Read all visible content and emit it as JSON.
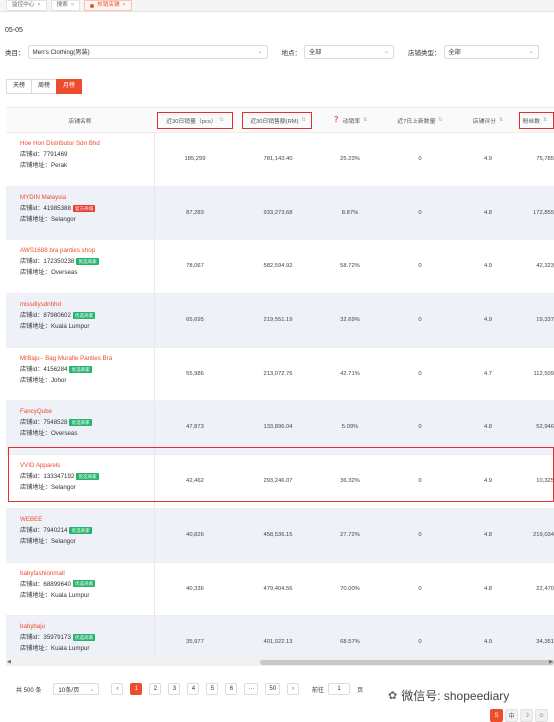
{
  "tabs": [
    {
      "label": "监控中心"
    },
    {
      "label": "搜索"
    },
    {
      "label": "热销店铺"
    }
  ],
  "date": "05-05",
  "filters": {
    "category_label": "类目：",
    "category_value": "Men's Clothing(男装)",
    "location_label": "地点：",
    "location_value": "全部",
    "shop_type_label": "店铺类型：",
    "shop_type_value": "全部"
  },
  "period": {
    "day": "天榜",
    "week": "周榜",
    "month": "月榜"
  },
  "columns": {
    "shop": "店铺名称",
    "sales30": "近30日销量（pcs）",
    "revenue30": "近30日销售额(RM)",
    "conversion": "动销率",
    "new7": "近7日上新数量",
    "rating": "店铺评分",
    "followers": "粉丝数"
  },
  "labels": {
    "shop_id": "店铺id：",
    "shop_addr": "店铺地址："
  },
  "rows": [
    {
      "name": "Hoe Hon Distributor Sdn Bhd",
      "id": "7791469",
      "badge": "",
      "addr": "Perak",
      "sales": "185,299",
      "revenue": "781,143.40",
      "conv": "25.23%",
      "new7": "0",
      "rating": "4.9",
      "fans": "75,785"
    },
    {
      "name": "MYDIN Malaysia",
      "id": "41985388",
      "badge": "官方商城",
      "badge_color": "#e53c2f",
      "addr": "Selangor",
      "sales": "87,283",
      "revenue": "933,273.68",
      "conv": "8.87%",
      "new7": "0",
      "rating": "4.8",
      "fans": "172,855"
    },
    {
      "name": "AWS1688 bra panties shop",
      "id": "172350238",
      "badge": "优选商家",
      "addr": "Overseas",
      "sales": "78,067",
      "revenue": "582,594.92",
      "conv": "58.72%",
      "new7": "0",
      "rating": "4.9",
      "fans": "42,323"
    },
    {
      "name": "missdiysdnbhd",
      "id": "87980602",
      "badge": "优选商家",
      "addr": "Kuala Lumpur",
      "sales": "65,695",
      "revenue": "219,551.19",
      "conv": "32.69%",
      "new7": "0",
      "rating": "4.9",
      "fans": "19,337"
    },
    {
      "name": "MrBaju - Bag Murafie Panties Bra",
      "id": "4156284",
      "badge": "优选商家",
      "addr": "Johor",
      "sales": "55,986",
      "revenue": "213,072.76",
      "conv": "42.71%",
      "new7": "0",
      "rating": "4.7",
      "fans": "112,509"
    },
    {
      "name": "FancyQube",
      "id": "7548528",
      "badge": "优选商家",
      "addr": "Overseas",
      "sales": "47,873",
      "revenue": "133,896.04",
      "conv": "5.09%",
      "new7": "0",
      "rating": "4.8",
      "fans": "52,946"
    },
    {
      "name": "VVID Apparels",
      "id": "133347192",
      "badge": "优选商家",
      "addr": "Selangor",
      "sales": "42,462",
      "revenue": "293,246.07",
      "conv": "36.32%",
      "new7": "0",
      "rating": "4.9",
      "fans": "10,325"
    },
    {
      "name": "WEBEE",
      "id": "7940214",
      "badge": "优选商家",
      "addr": "Selangor",
      "sales": "40,826",
      "revenue": "458,536.15",
      "conv": "27.72%",
      "new7": "0",
      "rating": "4.8",
      "fans": "219,034"
    },
    {
      "name": "babyfashionmall",
      "id": "68899640",
      "badge": "优选商家",
      "addr": "Kuala Lumpur",
      "sales": "40,336",
      "revenue": "479,404.56",
      "conv": "70.00%",
      "new7": "0",
      "rating": "4.8",
      "fans": "22,470"
    },
    {
      "name": "babybaju",
      "id": "35979173",
      "badge": "优选商家",
      "addr": "Kuala Lumpur",
      "sales": "35,977",
      "revenue": "401,022.13",
      "conv": "68.57%",
      "new7": "0",
      "rating": "4.9",
      "fans": "34,351"
    }
  ],
  "pager": {
    "total": "共 500 条",
    "page_size": "10条/页",
    "pages": [
      "1",
      "2",
      "3",
      "4",
      "5",
      "6",
      "···",
      "50"
    ],
    "goto": "前往",
    "goto_value": "1",
    "page_unit": "页"
  },
  "watermark": "微信号: shopeediary",
  "tools": [
    "S",
    "中",
    "☽",
    "☺"
  ]
}
